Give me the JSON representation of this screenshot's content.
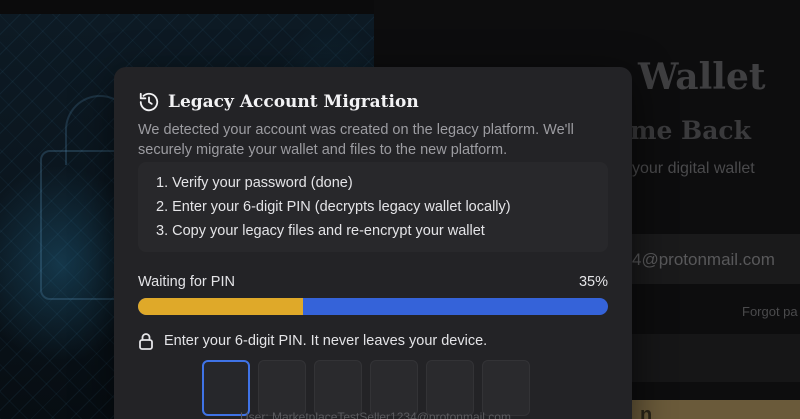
{
  "background": {
    "title": "Wallet",
    "subtitle": "me Back",
    "description": "your digital wallet",
    "email_value": "4@protonmail.com",
    "forgot_link": "Forgot pa",
    "login_button": "n"
  },
  "modal": {
    "icon": "history-icon",
    "title": "Legacy Account Migration",
    "description": "We detected your account was created on the legacy platform. We'll securely migrate your wallet and files to the new platform.",
    "steps": [
      "1. Verify your password (done)",
      "2. Enter your 6-digit PIN (decrypts legacy wallet locally)",
      "3. Copy your legacy files and re-encrypt your wallet"
    ],
    "status_label": "Waiting for PIN",
    "progress_text": "35%",
    "progress_fraction": 0.35,
    "pin_hint_icon": "lock-icon",
    "pin_hint": "Enter your 6-digit PIN. It never leaves your device.",
    "pin_length": 6,
    "footer_partial": "User: MarketplaceTestSeller1234@protonmail.com"
  },
  "colors": {
    "progress_done": "#dfa929",
    "progress_remaining": "#3563d9",
    "active_pin_border": "#3f73e6"
  }
}
